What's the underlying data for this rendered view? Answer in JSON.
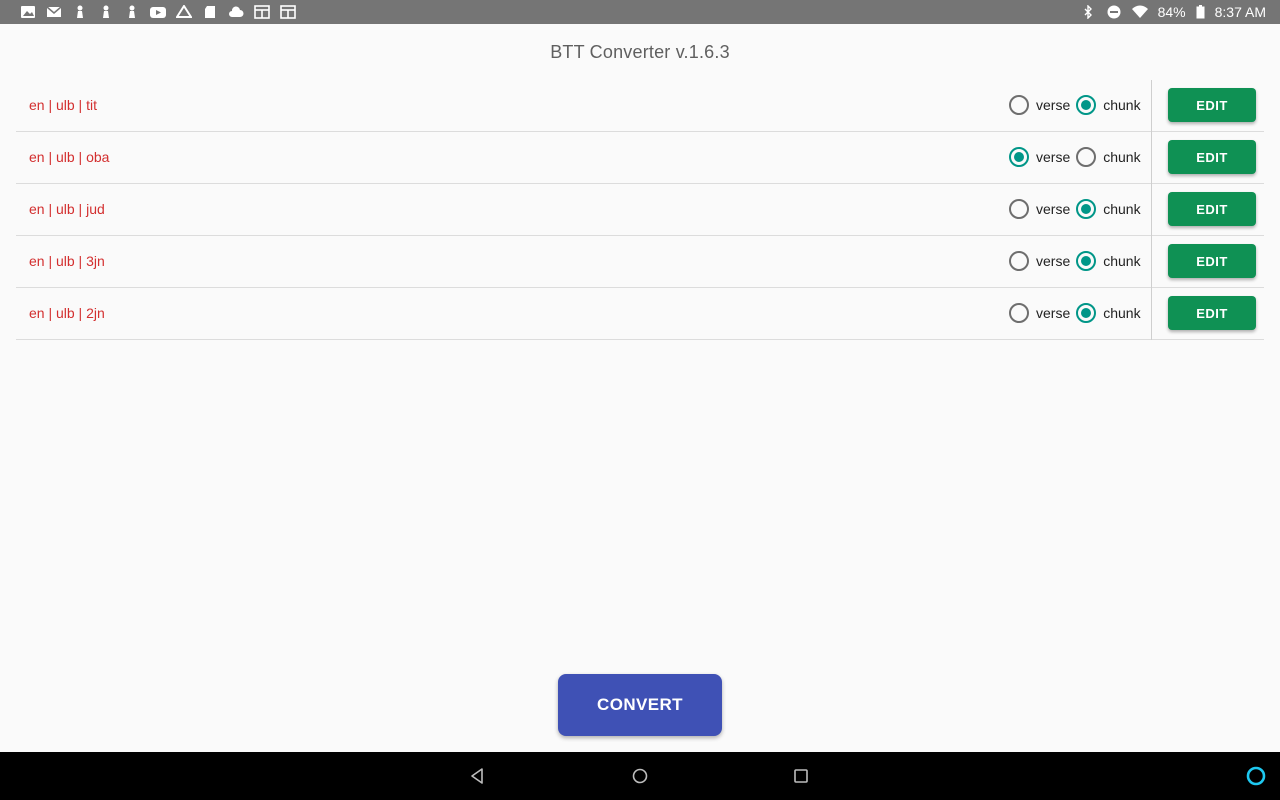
{
  "status_bar": {
    "battery": "84%",
    "time": "8:37 AM",
    "left_icons": [
      "image-icon",
      "mail-icon",
      "chess-icon",
      "chess-icon",
      "chess-icon",
      "youtube-icon",
      "drive-icon",
      "sd-card-icon",
      "cloud-icon",
      "calendar-icon",
      "calendar-icon"
    ],
    "right_icons": [
      "bluetooth-icon",
      "do-not-disturb-icon",
      "wifi-icon",
      "battery-icon"
    ]
  },
  "app": {
    "title": "BTT Converter v.1.6.3"
  },
  "projects": [
    {
      "name": "en | ulb | tit",
      "verse_label": "verse",
      "chunk_label": "chunk",
      "selected": "chunk",
      "edit_label": "EDIT"
    },
    {
      "name": "en | ulb | oba",
      "verse_label": "verse",
      "chunk_label": "chunk",
      "selected": "verse",
      "edit_label": "EDIT"
    },
    {
      "name": "en | ulb | jud",
      "verse_label": "verse",
      "chunk_label": "chunk",
      "selected": "chunk",
      "edit_label": "EDIT"
    },
    {
      "name": "en | ulb | 3jn",
      "verse_label": "verse",
      "chunk_label": "chunk",
      "selected": "chunk",
      "edit_label": "EDIT"
    },
    {
      "name": "en | ulb | 2jn",
      "verse_label": "verse",
      "chunk_label": "chunk",
      "selected": "chunk",
      "edit_label": "EDIT"
    }
  ],
  "convert_button": {
    "label": "CONVERT"
  },
  "nav_bar": {
    "buttons": [
      "back-icon",
      "home-icon",
      "recents-icon",
      "alexa-icon"
    ]
  },
  "colors": {
    "status_bar": "#757575",
    "project_name": "#d32f2f",
    "radio_checked": "#009688",
    "edit_button": "#0f9154",
    "convert_button": "#3f51b5",
    "nav_bar": "#000000",
    "alexa_accent": "#1ec8f0"
  }
}
